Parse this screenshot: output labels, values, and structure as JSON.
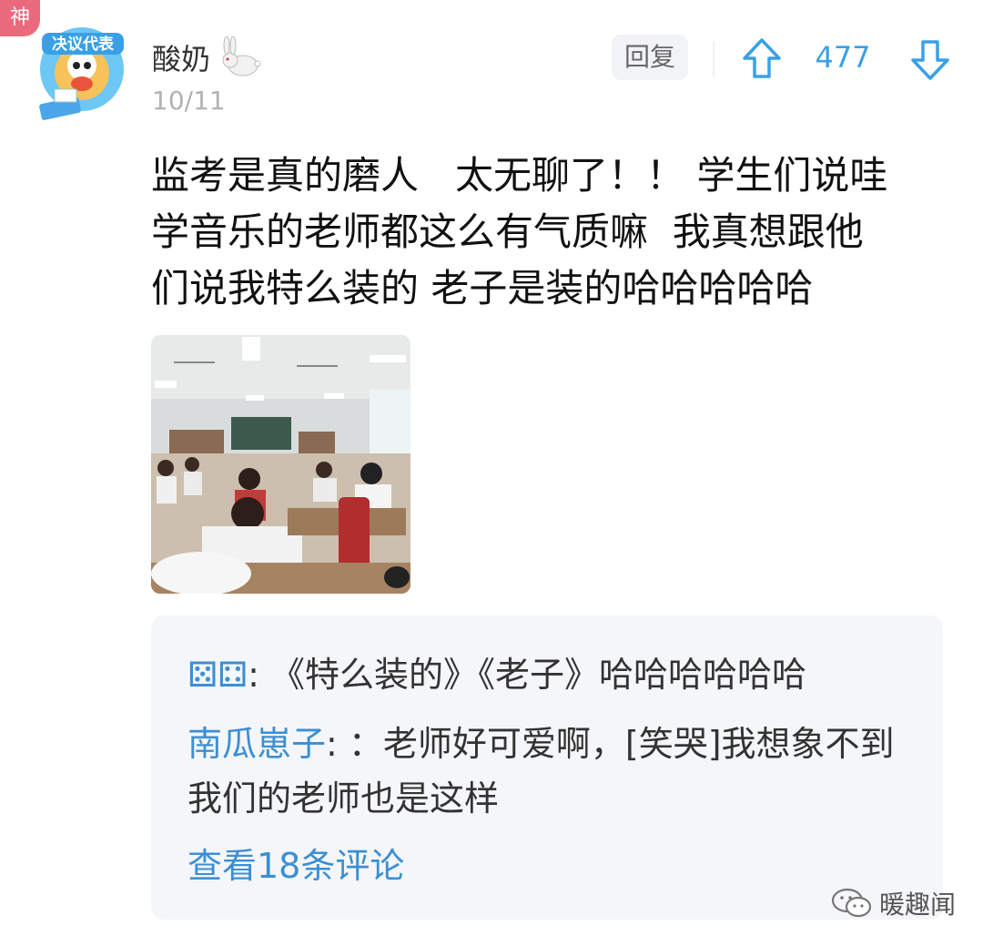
{
  "badge": "神",
  "user": {
    "name": "酸奶",
    "date": "10/11",
    "avatar_text": "决议代表"
  },
  "actions": {
    "reply_label": "回复",
    "vote_count": "477",
    "up_icon": "arrow-up-icon",
    "down_icon": "arrow-down-icon"
  },
  "post": {
    "lines": [
      "监考是真的磨人   太无聊了！！ 学生们说哇",
      "学音乐的老师都这么有气质嘛  我真想跟他",
      "们说我特么装的 老子是装的哈哈哈哈哈"
    ],
    "image": "classroom-exam-photo"
  },
  "comments": [
    {
      "author": "⚄⚃",
      "sep": ": ",
      "text": "《特么装的》《老子》哈哈哈哈哈哈"
    },
    {
      "author": "南瓜崽子",
      "sep": ": ",
      "text": "：老师好可爱啊，[笑哭]我想象不到我们的老师也是这样"
    }
  ],
  "view_more": "查看18条评论",
  "watermark": {
    "text": "暖趣闻",
    "icon": "wechat-icon"
  },
  "colors": {
    "accent": "#3aa0e6",
    "link": "#3c8fd4",
    "badge": "#e96a7c"
  }
}
